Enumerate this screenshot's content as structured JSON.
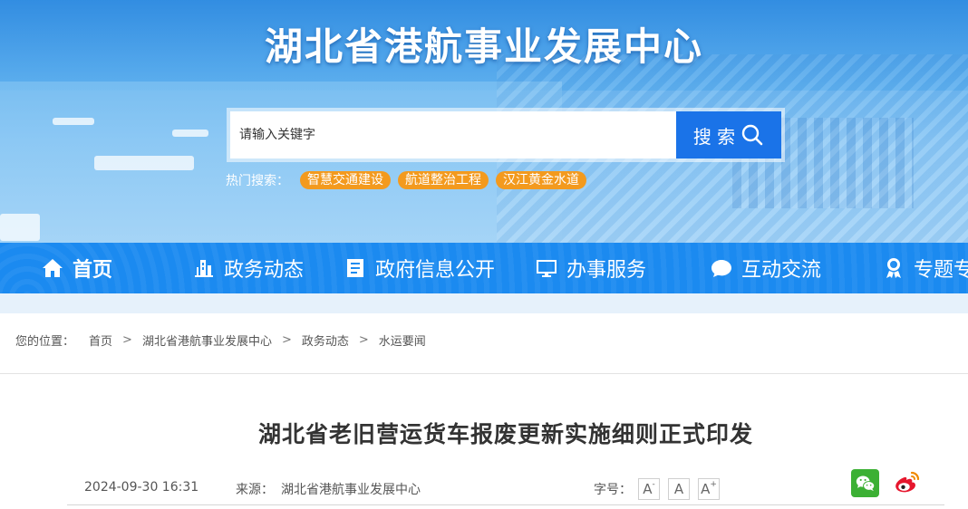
{
  "site": {
    "title": "湖北省港航事业发展中心"
  },
  "search": {
    "placeholder": "请输入关键字",
    "button_label": "搜 索"
  },
  "hot_search": {
    "label": "热门搜索：",
    "tags": [
      "智慧交通建设",
      "航道整治工程",
      "汉江黄金水道"
    ]
  },
  "nav": {
    "items": [
      {
        "label": "首页",
        "icon": "home-icon"
      },
      {
        "label": "政务动态",
        "icon": "building-icon"
      },
      {
        "label": "政府信息公开",
        "icon": "document-list-icon"
      },
      {
        "label": "办事服务",
        "icon": "monitor-icon"
      },
      {
        "label": "互动交流",
        "icon": "chat-bubble-icon"
      },
      {
        "label": "专题专",
        "icon": "award-medal-icon"
      }
    ]
  },
  "breadcrumb": {
    "prefix": "您的位置：",
    "items": [
      "首页",
      "湖北省港航事业发展中心",
      "政务动态",
      "水运要闻"
    ],
    "separator": ">"
  },
  "article": {
    "title": "湖北省老旧营运货车报废更新实施细则正式印发",
    "date": "2024-09-30 16:31",
    "source_label": "来源：",
    "source": "湖北省港航事业发展中心",
    "font_size_label": "字号：",
    "font_size_buttons": [
      "A-",
      "A",
      "A+"
    ]
  },
  "colors": {
    "nav_bg": "#1b8af0",
    "search_button": "#1a73e8",
    "hot_tag": "#f39a1e",
    "wechat": "#3cb034",
    "weibo": "#e6162d"
  }
}
